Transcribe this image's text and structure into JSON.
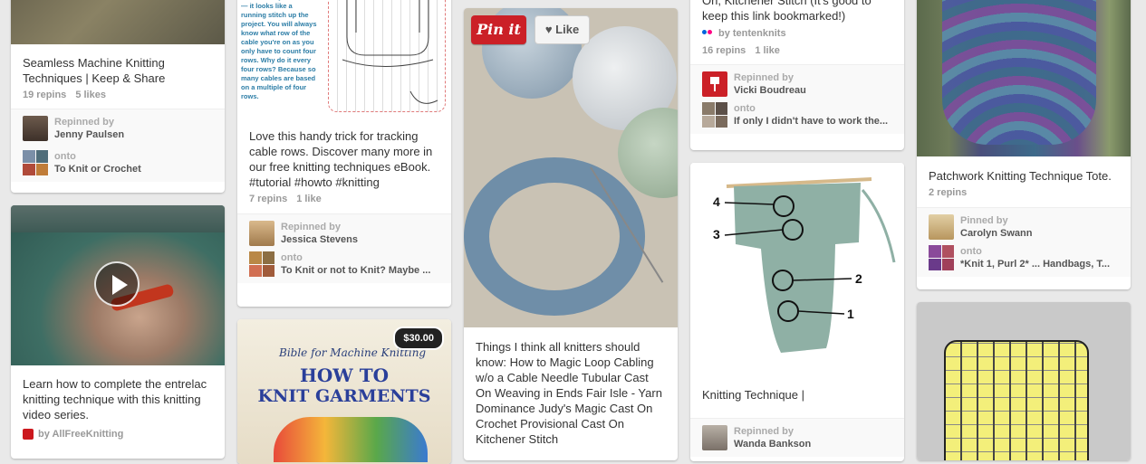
{
  "col1": {
    "pin1": {
      "description": "Seamless Machine Knitting Techniques | Keep & Share",
      "repins": "19 repins",
      "likes": "5 likes",
      "repinned_by_label": "Repinned by",
      "repinned_by": "Jenny Paulsen",
      "onto_label": "onto",
      "board": "To Knit or Crochet"
    },
    "pin2": {
      "description": "Learn how to complete the entrelac knitting technique with this knitting video series.",
      "source": "by AllFreeKnitting"
    }
  },
  "col2": {
    "pin1": {
      "image_text": "needle every four rows — it looks like a running stitch up the project. You will always know what row of the cable you're on as you only have to count four rows. Why do it every four rows? Because so many cables are based on a multiple of four rows.",
      "description": "Love this handy trick for tracking cable rows. Discover many more in our free knitting techniques eBook. #tutorial #howto #knitting",
      "repins": "7 repins",
      "likes": "1 like",
      "repinned_by_label": "Repinned by",
      "repinned_by": "Jessica Stevens",
      "onto_label": "onto",
      "board": "To Knit or not to Knit? Maybe ..."
    },
    "pin2": {
      "price": "$30.00",
      "book_header": "Bible for Machine Knitting",
      "book_title_line1": "HOW TO",
      "book_title_line2": "KNIT GARMENTS"
    }
  },
  "col3": {
    "pin1": {
      "pinit_label": "Pin it",
      "like_label": "Like",
      "description": "Things I think all knitters should know: How to Magic Loop Cabling w/o a Cable Needle Tubular Cast On Weaving in Ends Fair Isle - Yarn Dominance Judy's Magic Cast On Crochet Provisional Cast On Kitchener Stitch"
    }
  },
  "col4": {
    "pin1": {
      "description": "Oh, Kitchener Stitch (It's good to keep this link bookmarked!)",
      "source": "by tentenknits",
      "repins": "16 repins",
      "likes": "1 like",
      "repinned_by_label": "Repinned by",
      "repinned_by": "Vicki Boudreau",
      "onto_label": "onto",
      "board": "If only I didn't have to work the..."
    },
    "pin2": {
      "diagram_labels": [
        "4",
        "3",
        "2",
        "1"
      ],
      "description": "Knitting Technique |",
      "repinned_by_label": "Repinned by",
      "repinned_by": "Wanda Bankson"
    }
  },
  "col5": {
    "pin1": {
      "description": "Patchwork Knitting Technique Tote.",
      "repins": "2 repins",
      "pinned_by_label": "Pinned by",
      "pinned_by": "Carolyn Swann",
      "onto_label": "onto",
      "board": "*Knit 1, Purl 2* ... Handbags, T..."
    }
  },
  "colors": {
    "pinit_red": "#cb2027",
    "background": "#e9e9e9",
    "swatch_yellow": "#f3ef7a"
  }
}
